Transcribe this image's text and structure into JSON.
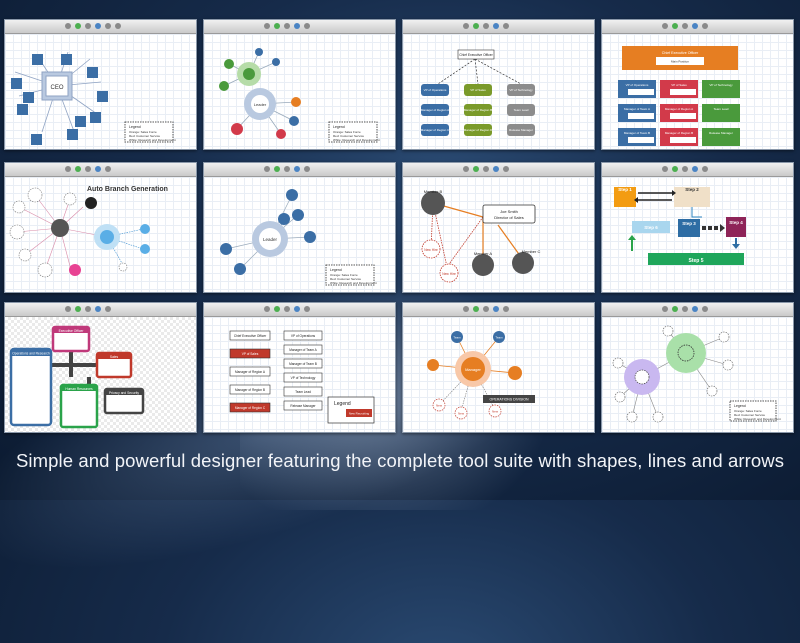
{
  "caption": "Simple and powerful designer featuring the complete tool suite with shapes, lines and arrows",
  "tiles": {
    "t1": {
      "center": "CEO",
      "team": "Team X",
      "legend_title": "Legend",
      "legend_lines": [
        "Orange: Sales Force",
        "Red: Customer Service",
        "White: Research and Development"
      ]
    },
    "t2": {
      "center": "Leader",
      "team": "Team",
      "legend_title": "Legend",
      "legend_lines": [
        "Orange: Sales Force",
        "Red: Customer Service",
        "White: Research and Development"
      ]
    },
    "t3": {
      "top": "Chief Executive Officer",
      "row1": [
        "VP of Operations",
        "VP of Sales",
        "VP of Technology"
      ],
      "row2": [
        "Manager of Region A",
        "Manager of Region B",
        "Team Lead"
      ],
      "row3": [
        "Manager of Region C",
        "Manager of Region D",
        "Release Manager"
      ]
    },
    "t4": {
      "top": "Chief Executive Officer",
      "top_sub": "Main Position",
      "row1": [
        "VP of Operations",
        "VP of Sales",
        "VP of Technology"
      ],
      "row2": [
        "Manager of Team A",
        "Manager of Region A",
        "Team Lead"
      ],
      "row3": [
        "Manager of Team B",
        "Manager of Region B",
        "Release Manager"
      ]
    },
    "t5": {
      "title": "Auto Branch Generation"
    },
    "t6": {
      "center": "Leader",
      "team": "Team",
      "legend_title": "Legend",
      "legend_lines": [
        "Orange: Sales Force",
        "Red: Customer Service",
        "White: Research and Development"
      ]
    },
    "t7": {
      "top_name": "Joe Smith",
      "top_role": "Director of Sales",
      "member_b": "Member B",
      "member_a": "Member A",
      "member_c": "Member C",
      "new_hire": "New Hire"
    },
    "t8": {
      "step1": "Step 1",
      "step2": "Step 2",
      "step3": "Step 3",
      "step4": "Step 4",
      "step5": "Step 5",
      "step6": "Step 6"
    },
    "t9": {
      "exec": "Executive Officer",
      "ops": "Operations and Research",
      "sales": "Sales",
      "hr": "Human Resources",
      "privacy": "Privacy and Security"
    },
    "t10": {
      "col1": [
        "Chief Executive Officer",
        "VP of Sales",
        "Manager of Region A",
        "Manager of Region B",
        "Manager of Region C"
      ],
      "col2": [
        "VP of Operations",
        "Manager of Team A",
        "Manager of Team B",
        "VP of Technology",
        "Team Lead",
        "Release Manager"
      ],
      "legend_title": "Legend",
      "legend_item": "New Recruiting"
    },
    "t11": {
      "center": "Manager",
      "node": "Team",
      "new": "New",
      "division": "OPERATIONS DIVISION"
    },
    "t12": {
      "legend_title": "Legend",
      "legend_lines": [
        "Orange: Sales Force",
        "Red: Customer Service",
        "White: Research and Development"
      ]
    }
  },
  "colors": {
    "blue": "#3b6ea5",
    "green": "#4a9a3c",
    "orange": "#e67e22",
    "red": "#d23a4a",
    "olive": "#7a9a2a",
    "gray": "#5a5a5a"
  }
}
